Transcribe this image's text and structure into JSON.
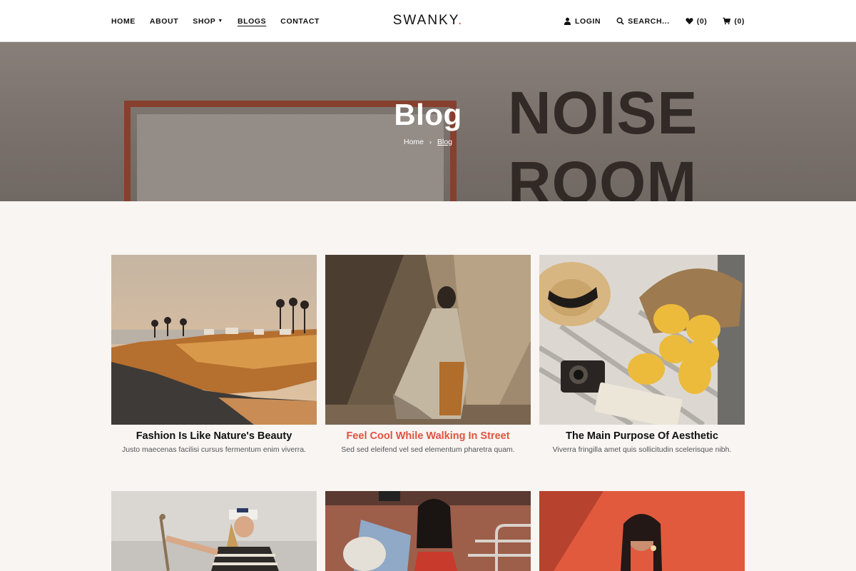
{
  "nav": {
    "left": [
      {
        "label": "HOME"
      },
      {
        "label": "ABOUT"
      },
      {
        "label": "SHOP"
      },
      {
        "label": "BLOGS"
      },
      {
        "label": "CONTACT"
      }
    ],
    "logo": "SWANKY",
    "logo_dot": ".",
    "login": "LOGIN",
    "search": "SEARCH...",
    "wishlist_count": "(0)",
    "cart_count": "(0)"
  },
  "hero": {
    "title": "Blog",
    "sign_line1": "NOISE",
    "sign_line2": "ROOM",
    "breadcrumb": {
      "home": "Home",
      "separator": "›",
      "current": "Blog"
    }
  },
  "posts": [
    {
      "title": "Fashion Is Like Nature's Beauty",
      "excerpt": "Justo maecenas facilisi cursus fermentum enim viverra."
    },
    {
      "title": "Feel Cool While Walking In Street",
      "excerpt": "Sed sed eleifend vel sed elementum pharetra quam."
    },
    {
      "title": "The Main Purpose Of Aesthetic",
      "excerpt": "Viverra fringilla amet quis sollicitudin scelerisque nibh."
    }
  ],
  "colors": {
    "accent": "#e0533f",
    "text": "#111111",
    "page_bg": "#f8f5f3"
  },
  "icons": {
    "login": "user-icon",
    "search": "search-icon",
    "wishlist": "heart-icon",
    "cart": "cart-icon",
    "shop_dropdown": "caret-down-icon"
  }
}
